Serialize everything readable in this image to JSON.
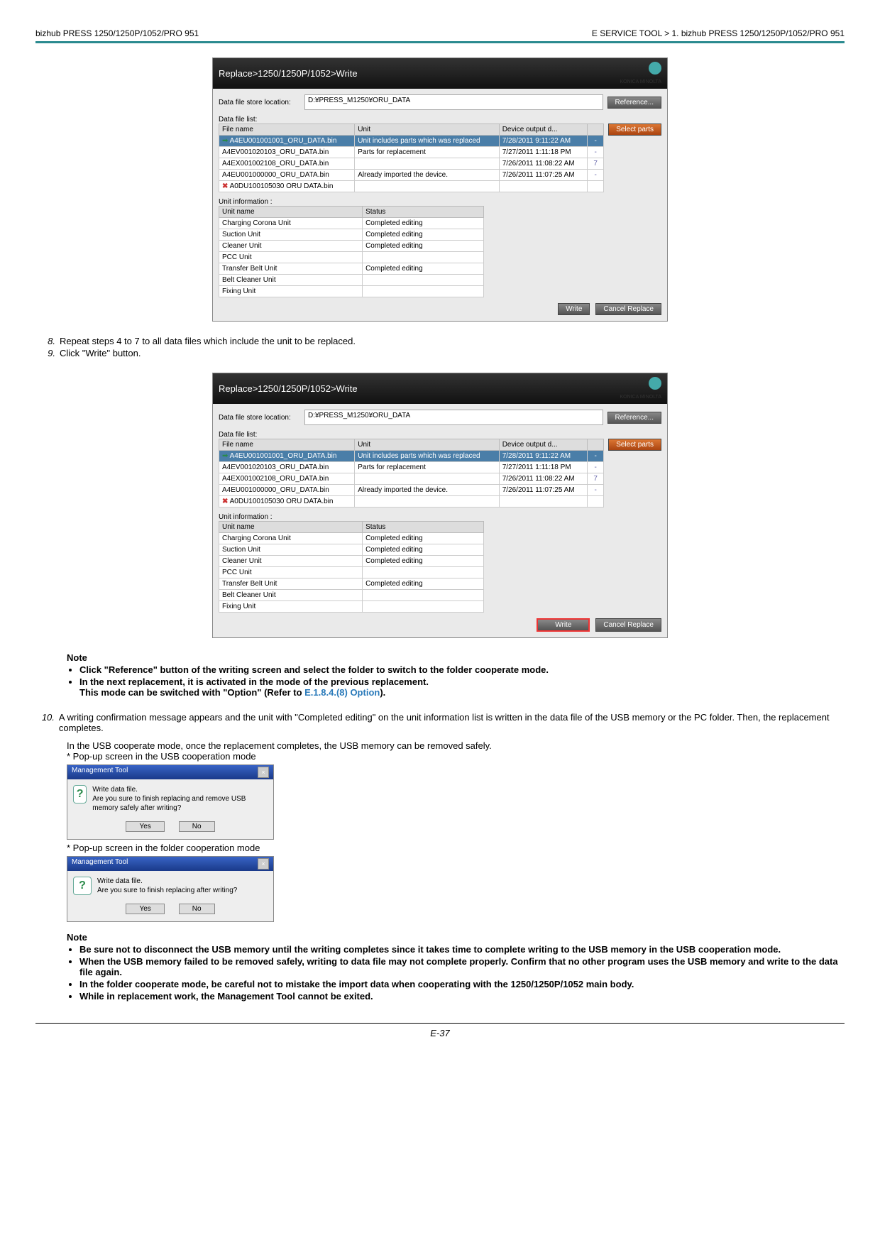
{
  "header": {
    "left": "bizhub PRESS 1250/1250P/1052/PRO 951",
    "right": "E SERVICE TOOL > 1.  bizhub PRESS 1250/1250P/1052/PRO 951"
  },
  "app1": {
    "title": "Replace>1250/1250P/1052>Write",
    "logo_text": "KONICA MINOLTA",
    "store_label": "Data file store location:",
    "store_path": "D:¥PRESS_M1250¥ORU_DATA",
    "reference_btn": "Reference...",
    "file_list_label": "Data file list:",
    "file_headers": [
      "File name",
      "Unit",
      "Device output d...",
      ""
    ],
    "select_parts_btn": "Select parts",
    "files": [
      {
        "name": "A4EU001001001_ORU_DATA.bin",
        "unit": "Unit includes parts which was replaced",
        "date": "7/28/2011 9:11:22 AM",
        "n": "-",
        "sel": true
      },
      {
        "name": "A4EV001020103_ORU_DATA.bin",
        "unit": "Parts for replacement",
        "date": "7/27/2011 1:11:18 PM",
        "n": "-"
      },
      {
        "name": "A4EX001002108_ORU_DATA.bin",
        "unit": "",
        "date": "7/26/2011 11:08:22 AM",
        "n": "7"
      },
      {
        "name": "A4EU001000000_ORU_DATA.bin",
        "unit": "Already imported the device.",
        "date": "7/26/2011 11:07:25 AM",
        "n": "-"
      },
      {
        "name": "A0DU100105030 ORU DATA.bin",
        "unit": "",
        "date": "",
        "n": "",
        "x": true
      }
    ],
    "unit_info_label": "Unit information :",
    "unit_headers": [
      "Unit name",
      "Status"
    ],
    "unit_rows": [
      {
        "name": "Charging Corona Unit",
        "status": "Completed editing"
      },
      {
        "name": "Suction Unit",
        "status": "Completed editing"
      },
      {
        "name": "Cleaner Unit",
        "status": "Completed editing"
      },
      {
        "name": "PCC Unit",
        "status": ""
      },
      {
        "name": "Transfer Belt Unit",
        "status": "Completed editing"
      },
      {
        "name": "Belt Cleaner Unit",
        "status": ""
      },
      {
        "name": "Fixing Unit",
        "status": ""
      }
    ],
    "write_btn": "Write",
    "cancel_btn": "Cancel Replace"
  },
  "steps_a": [
    {
      "n": "8.",
      "text": "Repeat steps 4 to 7 to all data files which include the unit to be replaced."
    },
    {
      "n": "9.",
      "text": "Click \"Write\" button."
    }
  ],
  "app2": {
    "title": "Replace>1250/1250P/1052>Write",
    "unit_rows": [
      {
        "name": "Charging Corona Unit",
        "status": "Completed editing"
      },
      {
        "name": "Suction Unit",
        "status": "Completed editing"
      },
      {
        "name": "Cleaner Unit",
        "status": "Completed editing"
      },
      {
        "name": "PCC Unit",
        "status": ""
      },
      {
        "name": "Transfer Belt Unit",
        "status": "Completed editing"
      },
      {
        "name": "Belt Cleaner Unit",
        "status": ""
      },
      {
        "name": "Fixing Unit",
        "status": ""
      }
    ]
  },
  "note1": {
    "title": "Note",
    "bullets": [
      "Click \"Reference\" button of the writing screen and select the folder to switch to the folder cooperate mode.",
      "In the next replacement, it is activated in the mode of the previous replacement."
    ],
    "extra_line": "This mode can be switched with \"Option\" (Refer to ",
    "link": "E.1.8.4.(8) Option",
    "extra_tail": ")."
  },
  "steps_b": [
    {
      "n": "10.",
      "text": "A writing confirmation message appears and the unit with \"Completed editing\" on the unit information list is written in the data file of the USB memory or the PC folder. Then, the replacement completes."
    }
  ],
  "sub_lines": [
    "In the USB cooperate mode, once the replacement completes, the USB memory can be removed safely.",
    "* Pop-up screen in the USB cooperation mode"
  ],
  "popup1": {
    "title": "Management Tool",
    "msg1": "Write data file.",
    "msg2": "Are you sure to finish replacing and remove USB memory safely after writing?",
    "yes": "Yes",
    "no": "No"
  },
  "sub_line2": "* Pop-up screen in the folder cooperation mode",
  "popup2": {
    "title": "Management Tool",
    "msg1": "Write data file.",
    "msg2": "Are you sure to finish replacing after writing?",
    "yes": "Yes",
    "no": "No"
  },
  "note2": {
    "title": "Note",
    "bullets": [
      "Be sure not to disconnect the USB memory until the writing completes since it takes time to complete writing to the USB memory in the USB cooperation mode.",
      "When the USB memory failed to be removed safely, writing to data file may not complete properly. Confirm that no other program uses the USB memory and write to the data file again.",
      "In the folder cooperate mode, be careful not to mistake the import data when cooperating with the 1250/1250P/1052 main body.",
      "While in replacement work, the Management Tool cannot be exited."
    ]
  },
  "page_num": "E-37"
}
